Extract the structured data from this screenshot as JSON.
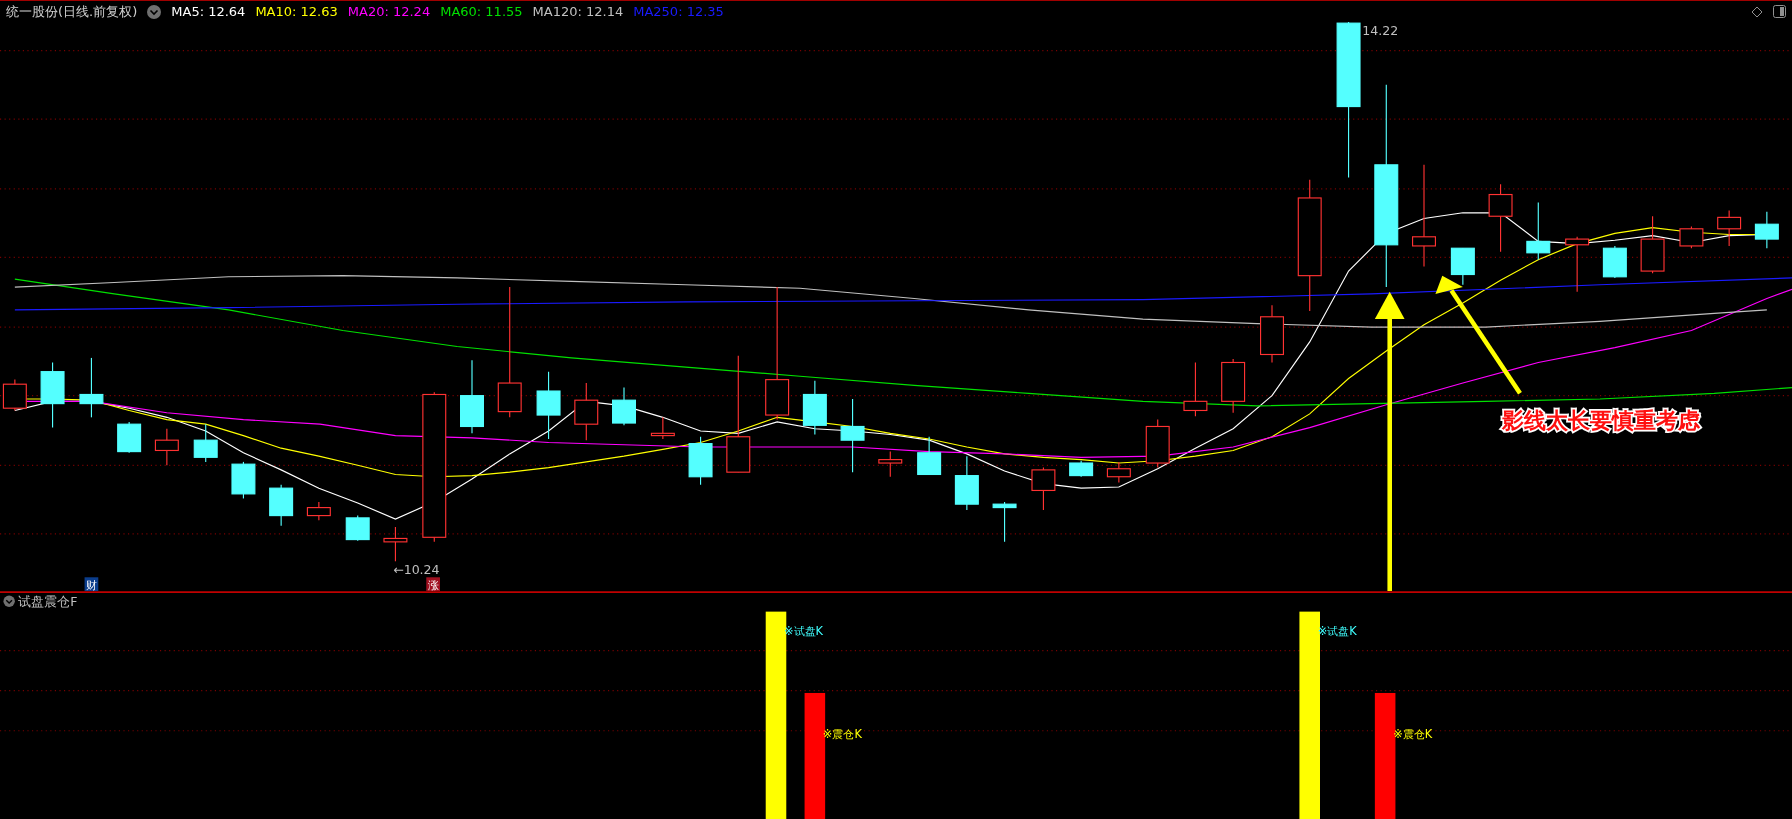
{
  "header": {
    "title": "统一股份(日线.前复权)",
    "ma": [
      {
        "label": "MA5: 12.64",
        "color": "#ffffff"
      },
      {
        "label": "MA10: 12.63",
        "color": "#ffff00"
      },
      {
        "label": "MA20: 12.24",
        "color": "#ff00ff"
      },
      {
        "label": "MA60: 11.55",
        "color": "#00e000"
      },
      {
        "label": "MA120: 12.14",
        "color": "#c0c0c0"
      },
      {
        "label": "MA250: 12.35",
        "color": "#1a1aff"
      }
    ]
  },
  "main_chart": {
    "high_label": "14.22",
    "low_label": "←10.24",
    "markers": [
      {
        "text": "财",
        "color": "#0b3d8c"
      },
      {
        "text": "涨",
        "color": "#a01020"
      }
    ],
    "annotation": "影线太长要慎重考虑"
  },
  "indicator": {
    "title": "试盘震仓F",
    "signals": [
      {
        "kind": "probe",
        "label": "※试盘K"
      },
      {
        "kind": "shake",
        "label": "※震仓K"
      },
      {
        "kind": "probe",
        "label": "※试盘K"
      },
      {
        "kind": "shake",
        "label": "※震仓K"
      }
    ]
  }
}
